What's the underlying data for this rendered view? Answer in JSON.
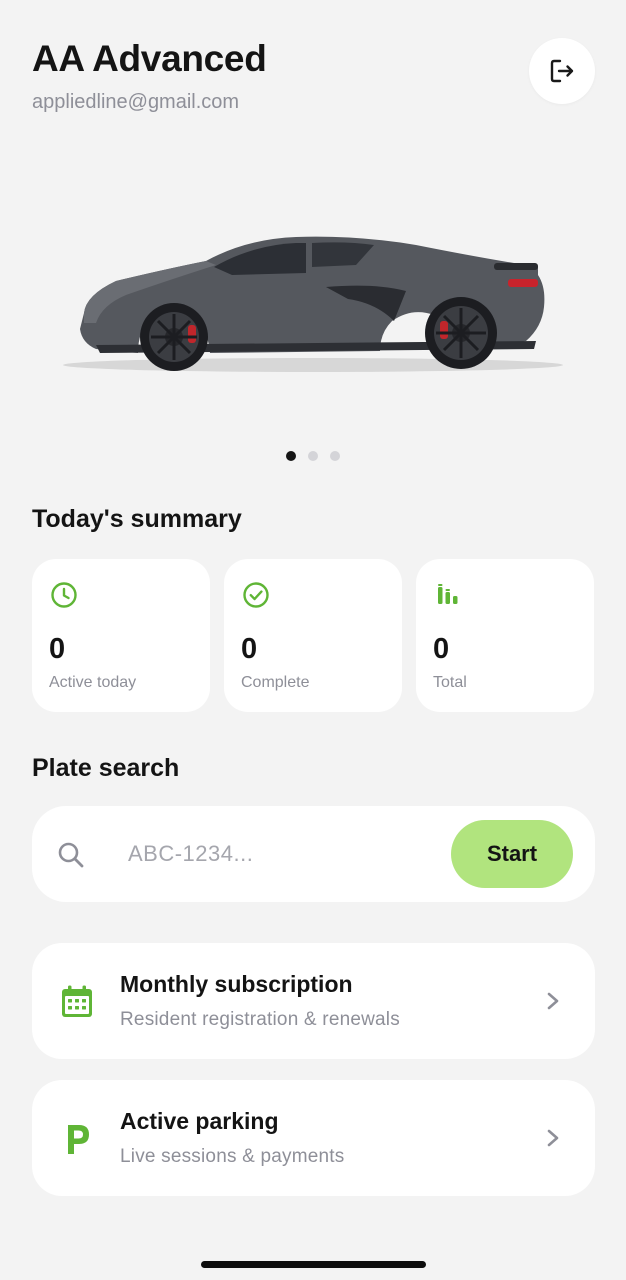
{
  "header": {
    "name": "AA Advanced",
    "email": "appliedline@gmail.com",
    "logout_icon": "logout-icon"
  },
  "carousel": {
    "image": "gray-sports-car",
    "page_count": 3,
    "active_index": 0
  },
  "summary": {
    "title": "Today's summary",
    "cards": [
      {
        "icon": "clock-icon",
        "value": "0",
        "label": "Active today"
      },
      {
        "icon": "check-circle-icon",
        "value": "0",
        "label": "Complete"
      },
      {
        "icon": "bar-chart-icon",
        "value": "0",
        "label": "Total"
      }
    ]
  },
  "plate_search": {
    "title": "Plate search",
    "placeholder": "ABC-1234...",
    "button_label": "Start"
  },
  "menu": [
    {
      "icon": "calendar-icon",
      "title": "Monthly subscription",
      "subtitle": "Resident registration & renewals"
    },
    {
      "icon": "parking-icon",
      "title": "Active parking",
      "subtitle": "Live sessions & payments"
    }
  ],
  "colors": {
    "accent": "#5fb536",
    "button": "#b1e47e",
    "background": "#f3f3f3",
    "muted_text": "#8e8f98"
  }
}
